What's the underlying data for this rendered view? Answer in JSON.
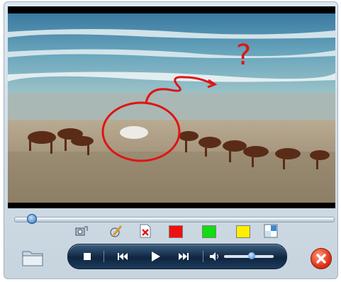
{
  "window": {
    "title": ""
  },
  "video": {
    "annotation": "?",
    "annotation_color": "#e01414"
  },
  "seek": {
    "position": 0.05
  },
  "toolbar": {
    "tools": [
      "screenshot-icon",
      "pen-icon",
      "clear-drawing-icon"
    ],
    "pen_colors": [
      "#ee1111",
      "#11dd11",
      "#ffee00"
    ],
    "extra": "window-layout-icon"
  },
  "controls": {
    "buttons": [
      "stop-icon",
      "previous-icon",
      "play-icon",
      "next-icon",
      "volume-icon"
    ],
    "volume": 0.55
  },
  "colors": {
    "accent": "#2f6fb6",
    "close": "#e0341a"
  }
}
